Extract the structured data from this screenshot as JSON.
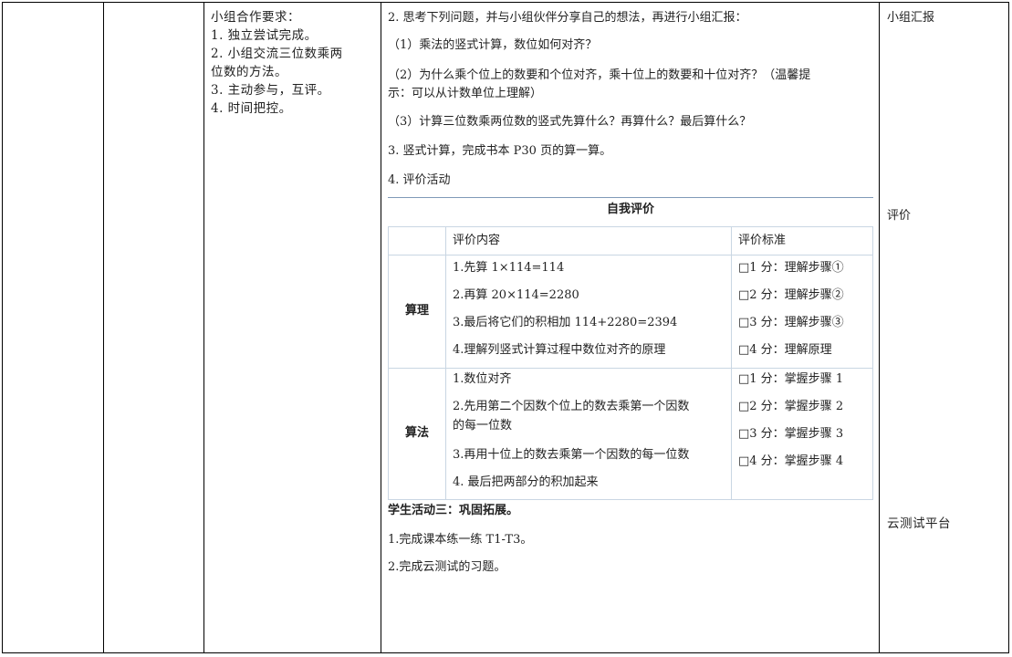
{
  "col3": {
    "heading": "小组合作要求：",
    "items": [
      "1. 独立尝试完成。",
      "2. 小组交流三位数乘两",
      "位数的方法。",
      "3. 主动参与，互评。",
      "4. 时间把控。"
    ]
  },
  "col4": {
    "intro": "2. 思考下列问题，并与小组伙伴分享自己的想法，再进行小组汇报：",
    "q1": "（1）乘法的竖式计算，数位如何对齐？",
    "q2a": "（2）为什么乘个位上的数要和个位对齐，乘十位上的数要和十位对齐？（温馨提",
    "q2b": "示：可以从计数单位上理解）",
    "q3": "（3）计算三位数乘两位数的竖式先算什么？再算什么？最后算什么？",
    "step3": "3. 竖式计算，完成书本 P30 页的算一算。",
    "step4": "4. 评价活动",
    "eval_table": {
      "title": "自我评价",
      "header_content": "评价内容",
      "header_standard": "评价标准",
      "groups": [
        {
          "label": "算理",
          "contents": [
            "1.先算 1×114=114",
            "2.再算 20×114=2280",
            "3.最后将它们的积相加 114+2280=2394",
            "4.理解列竖式计算过程中数位对齐的原理"
          ],
          "standards": [
            "□1 分：理解步骤①",
            "□2 分：理解步骤②",
            "□3 分：理解步骤③",
            "□4 分：理解原理"
          ]
        },
        {
          "label": "算法",
          "contents": [
            "1.数位对齐",
            "2.先用第二个因数个位上的数去乘第一个因数",
            "的每一位数",
            "3.再用十位上的数去乘第一个因数的每一位数",
            "4. 最后把两部分的积加起来"
          ],
          "standards": [
            "□1 分：掌握步骤 1",
            "□2 分：掌握步骤 2",
            "□3 分：掌握步骤 3",
            "□4 分：掌握步骤 4"
          ]
        }
      ]
    },
    "activity3_title": "学生活动三：巩固拓展。",
    "activity3_items": [
      "1.完成课本练一练 T1-T3。",
      "2.完成云测试的习题。"
    ]
  },
  "col5": {
    "label1": "小组汇报",
    "label2": "评价",
    "label3": "云测试平台"
  }
}
